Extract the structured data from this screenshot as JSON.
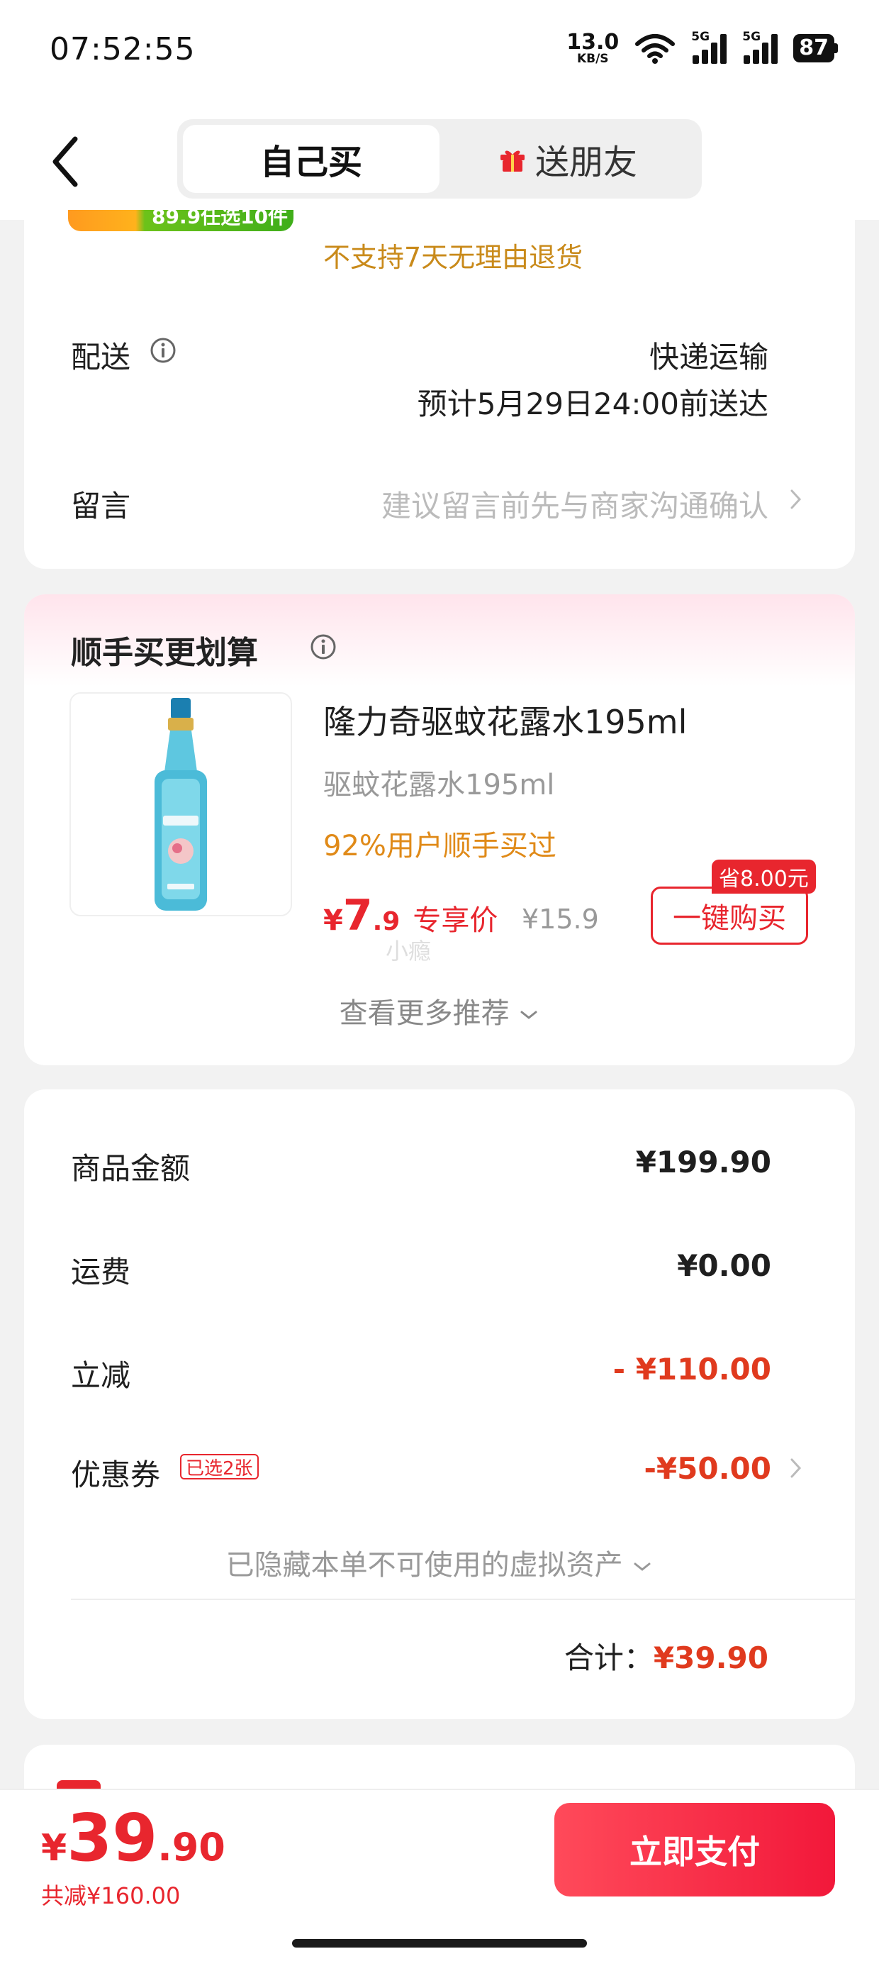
{
  "status_bar": {
    "time": "07:52:55",
    "net_speed_value": "13.0",
    "net_speed_unit": "KB/S",
    "signal1_label": "5G",
    "signal2_label": "5G",
    "battery": "87"
  },
  "header": {
    "tab_self": "自己买",
    "tab_gift": "送朋友"
  },
  "shipping_card": {
    "promo_badge_partial": "89.9任选10件",
    "no_return_note": "不支持7天无理由退货",
    "delivery_label": "配送",
    "delivery_method": "快递运输",
    "delivery_estimate": "预计5月29日24:00前送达",
    "message_label": "留言",
    "message_placeholder": "建议留言前先与商家沟通确认"
  },
  "addon_card": {
    "title": "顺手买更划算",
    "product_name": "隆力奇驱蚊花露水195ml",
    "product_spec": "驱蚊花露水195ml",
    "buy_stat": "92%用户顺手买过",
    "price_yen": "¥",
    "price_int": "7",
    "price_dec": ".9",
    "price_tag": "专享价",
    "original_price": "¥15.9",
    "save_badge": "省8.00元",
    "buy_button": "一键购买",
    "watermark": "小瘾",
    "more_recommend": "查看更多推荐"
  },
  "summary_card": {
    "goods_amount_label": "商品金额",
    "goods_amount_value": "¥199.90",
    "shipping_fee_label": "运费",
    "shipping_fee_value": "¥0.00",
    "instant_discount_label": "立减",
    "instant_discount_value": "- ¥110.00",
    "coupon_label": "优惠券",
    "coupon_tag": "已选2张",
    "coupon_value": "-¥50.00",
    "hidden_assets": "已隐藏本单不可使用的虚拟资产",
    "total_label": "合计：",
    "total_value": "¥39.90"
  },
  "bottom_bar": {
    "pay_yen": "¥",
    "pay_int": "39",
    "pay_dec": ".90",
    "saved_total": "共减¥160.00",
    "pay_button": "立即支付"
  },
  "colors": {
    "accent_red": "#e8262e",
    "price_red": "#e03a1e",
    "highlight_orange": "#e08a18"
  }
}
